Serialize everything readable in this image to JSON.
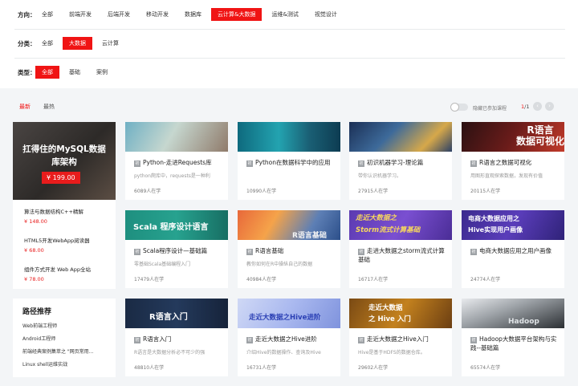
{
  "filters": {
    "direction": {
      "label": "方向：",
      "options": [
        "全部",
        "前端开发",
        "后端开发",
        "移动开发",
        "数据库",
        "云计算&大数据",
        "运维&测试",
        "视觉设计"
      ],
      "active": 5
    },
    "category": {
      "label": "分类：",
      "options": [
        "全部",
        "大数据",
        "云计算"
      ],
      "active": 1
    },
    "type": {
      "label": "类型：",
      "options": [
        "全部",
        "基础",
        "案例"
      ],
      "active": 0
    }
  },
  "sortbar": {
    "newest": "最新",
    "hottest": "最热",
    "hide_label": "隐藏已参加课程",
    "page_current": "1",
    "page_total": "/1",
    "prev_icon": "chevron-left-icon",
    "next_icon": "chevron-right-icon"
  },
  "promo": {
    "banner_title": "扛得住的MySQL数据库架构",
    "banner_price": "¥ 199.00",
    "items": [
      {
        "name": "算法与数据结构C++精解",
        "price": "¥ 148.00"
      },
      {
        "name": "HTML5开发WebApp阅读器",
        "price": "¥ 68.00"
      },
      {
        "name": "组件方式开发 Web App全站",
        "price": "¥ 78.00"
      }
    ]
  },
  "paths": {
    "title": "路径推荐",
    "items": [
      "Web前端工程师",
      "Android工程师",
      "前端经典案例集萃之 \"网页常用…",
      "Linux shell运维实战"
    ]
  },
  "cards": [
    {
      "img_text": "",
      "title": "Python-走进Requests库",
      "desc": "python爬库中，requests是一种利",
      "students": "6089人在学"
    },
    {
      "img_text": "",
      "title": "Python在数据科学中的应用",
      "desc": "",
      "students": "10990人在学"
    },
    {
      "img_text": "",
      "title": "初识机器学习-理论篇",
      "desc": "带你认识机器学习。",
      "students": "27915人在学"
    },
    {
      "img_text": "R语言\n数据可视化",
      "title": "R语言之数据可视化",
      "desc": "用图形直观探索数据，发现有价值",
      "students": "20115人在学"
    },
    {
      "img_text": "Scala 程序设计语言",
      "title": "Scala程序设计—基础篇",
      "desc": "零基础Scala基础编程入门",
      "students": "17479人在学"
    },
    {
      "img_text": "R语言基础",
      "title": "R语言基础",
      "desc": "教你如何在R中操纵自己的数据",
      "students": "40984人在学"
    },
    {
      "img_text": "走近大数据之\nStorm流式计算基础",
      "title": "走进大数据之storm流式计算基础",
      "desc": "",
      "students": "16717人在学"
    },
    {
      "img_text": "电商大数据应用之\nHive实现用户画像",
      "title": "电商大数据应用之用户画像",
      "desc": "",
      "students": "24774人在学"
    },
    {
      "img_text": "R语言入门",
      "title": "R语言入门",
      "desc": "R语言是大数据分析必不可少的强",
      "students": "48810人在学"
    },
    {
      "img_text": "走近大数据之Hive进阶",
      "title": "走近大数据之Hive进阶",
      "desc": "介绍Hive的数据操作、查询及Hive",
      "students": "16731人在学"
    },
    {
      "img_text": "走近大数据\n之 Hive 入门",
      "title": "走近大数据之Hive入门",
      "desc": "Hive是基于HDFS的数据仓库。",
      "students": "29602人在学"
    },
    {
      "img_text": "Hadoop",
      "title": "Hadoop大数据平台架构与实践--基础篇",
      "desc": "",
      "students": "65574人在学"
    }
  ],
  "colors": {
    "accent": "#f01414",
    "background": "#f3f5f7"
  }
}
